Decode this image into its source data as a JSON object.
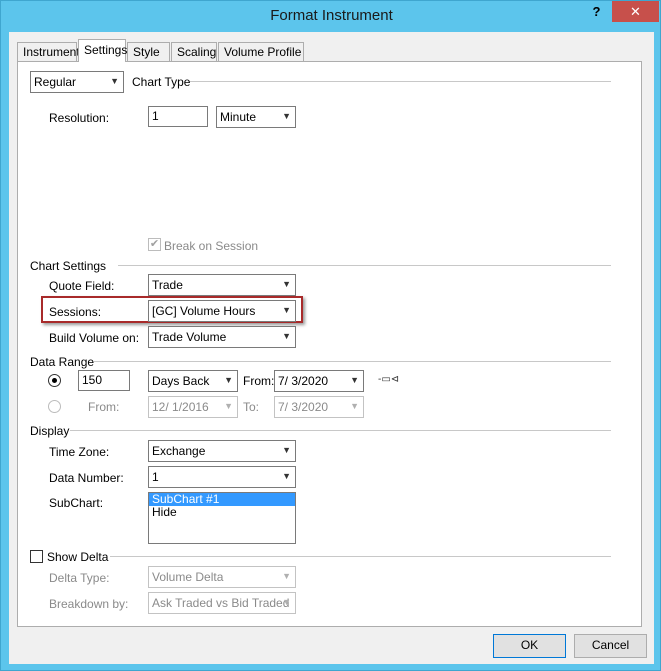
{
  "window": {
    "title": "Format Instrument",
    "help": "?",
    "close": "✕"
  },
  "tabs": [
    "Instrument",
    "Settings",
    "Style",
    "Scaling",
    "Volume Profile"
  ],
  "chart_type": {
    "value": "Regular",
    "label": "Chart Type"
  },
  "resolution": {
    "label": "Resolution:",
    "value": "1",
    "unit": "Minute"
  },
  "break_on_session": {
    "label": "Break on Session",
    "checked": "✔"
  },
  "chart_settings": {
    "heading": "Chart Settings",
    "quote_field": {
      "label": "Quote Field:",
      "value": "Trade"
    },
    "sessions": {
      "label": "Sessions:",
      "value": "[GC] Volume Hours"
    },
    "build_volume": {
      "label": "Build Volume on:",
      "value": "Trade Volume"
    }
  },
  "data_range": {
    "heading": "Data Range",
    "count": "150",
    "mode": "Days Back",
    "from_label": "From:",
    "from_date": "7/  3/2020",
    "from2_label": "From:",
    "from2_date": "12/  1/2016",
    "to_label": "To:",
    "to_date": "7/  3/2020",
    "pin_icon": "-▭⊲"
  },
  "display": {
    "heading": "Display",
    "time_zone": {
      "label": "Time Zone:",
      "value": "Exchange"
    },
    "data_number": {
      "label": "Data Number:",
      "value": "1"
    },
    "subchart": {
      "label": "SubChart:",
      "items": [
        "SubChart #1",
        "Hide"
      ]
    }
  },
  "show_delta": {
    "label": "Show Delta",
    "delta_type": {
      "label": "Delta Type:",
      "value": "Volume Delta"
    },
    "breakdown": {
      "label": "Breakdown by:",
      "value": "Ask Traded vs Bid Traded"
    }
  },
  "buttons": {
    "ok": "OK",
    "cancel": "Cancel"
  },
  "dropdown_arrow": "▼"
}
